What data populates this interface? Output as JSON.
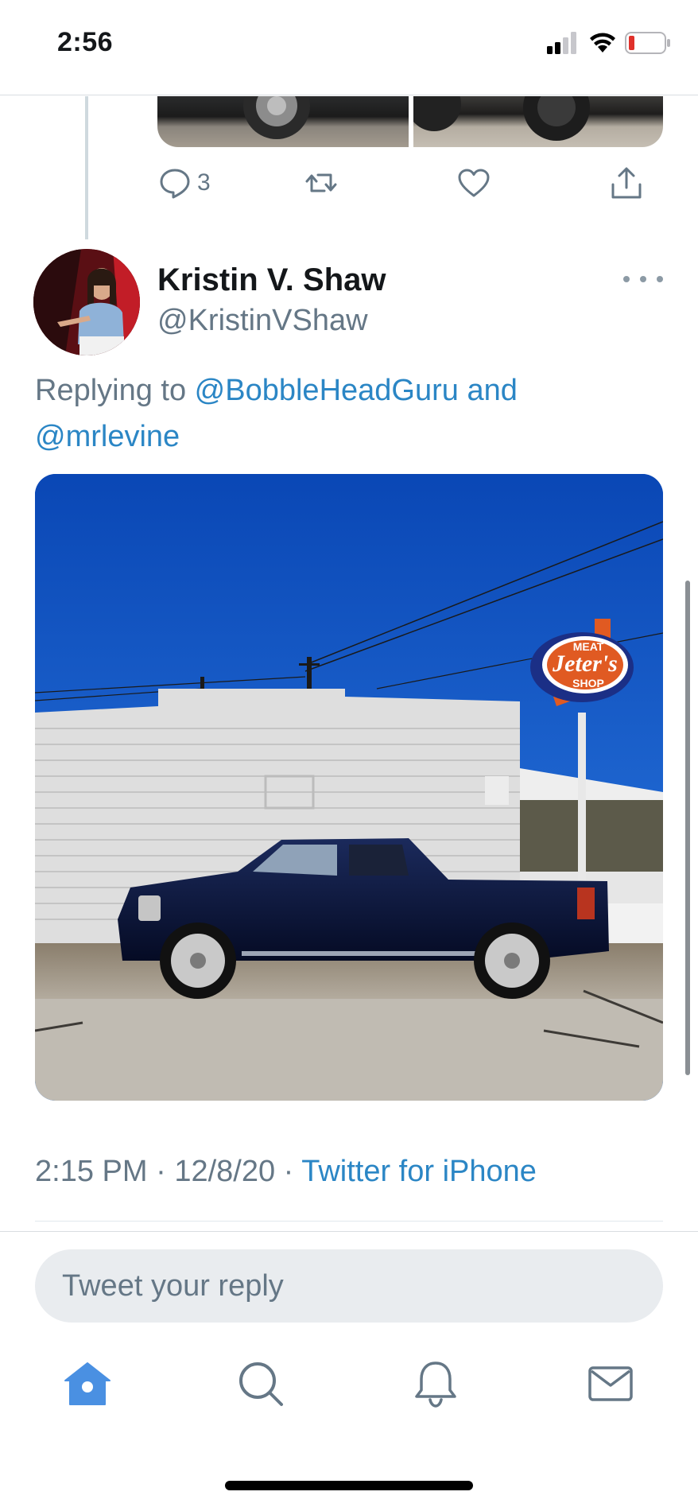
{
  "status_bar": {
    "time": "2:56",
    "battery_level": 0.1,
    "colors": {
      "battery_low": "#e0312b"
    }
  },
  "previous_tweet": {
    "actions": {
      "reply": {
        "icon": "reply-icon",
        "count": "3"
      },
      "retweet": {
        "icon": "retweet-icon"
      },
      "like": {
        "icon": "heart-icon"
      },
      "share": {
        "icon": "share-icon"
      }
    }
  },
  "tweet": {
    "author": {
      "display_name": "Kristin V. Shaw",
      "handle": "@KristinVShaw"
    },
    "replying_prefix": "Replying to ",
    "replying_to": {
      "first": "@BobbleHeadGuru",
      "conjunction": "and",
      "second": "@mrlevine"
    },
    "image": {
      "sign_line1": "MEAT",
      "sign_line2": "Jeter's",
      "sign_line3": "SHOP"
    },
    "time": "2:15 PM",
    "separator": " · ",
    "date": "12/8/20",
    "source": "Twitter for iPhone"
  },
  "reply": {
    "placeholder": "Tweet your reply",
    "value": ""
  },
  "tab_bar": {
    "tabs": [
      {
        "name": "home",
        "icon": "home-icon",
        "active": true
      },
      {
        "name": "search",
        "icon": "search-icon",
        "active": false
      },
      {
        "name": "notifications",
        "icon": "bell-icon",
        "active": false
      },
      {
        "name": "messages",
        "icon": "mail-icon",
        "active": false
      }
    ]
  },
  "colors": {
    "accent": "#2b86c5",
    "active_tab": "#4a90e2",
    "secondary_text": "#657786"
  }
}
